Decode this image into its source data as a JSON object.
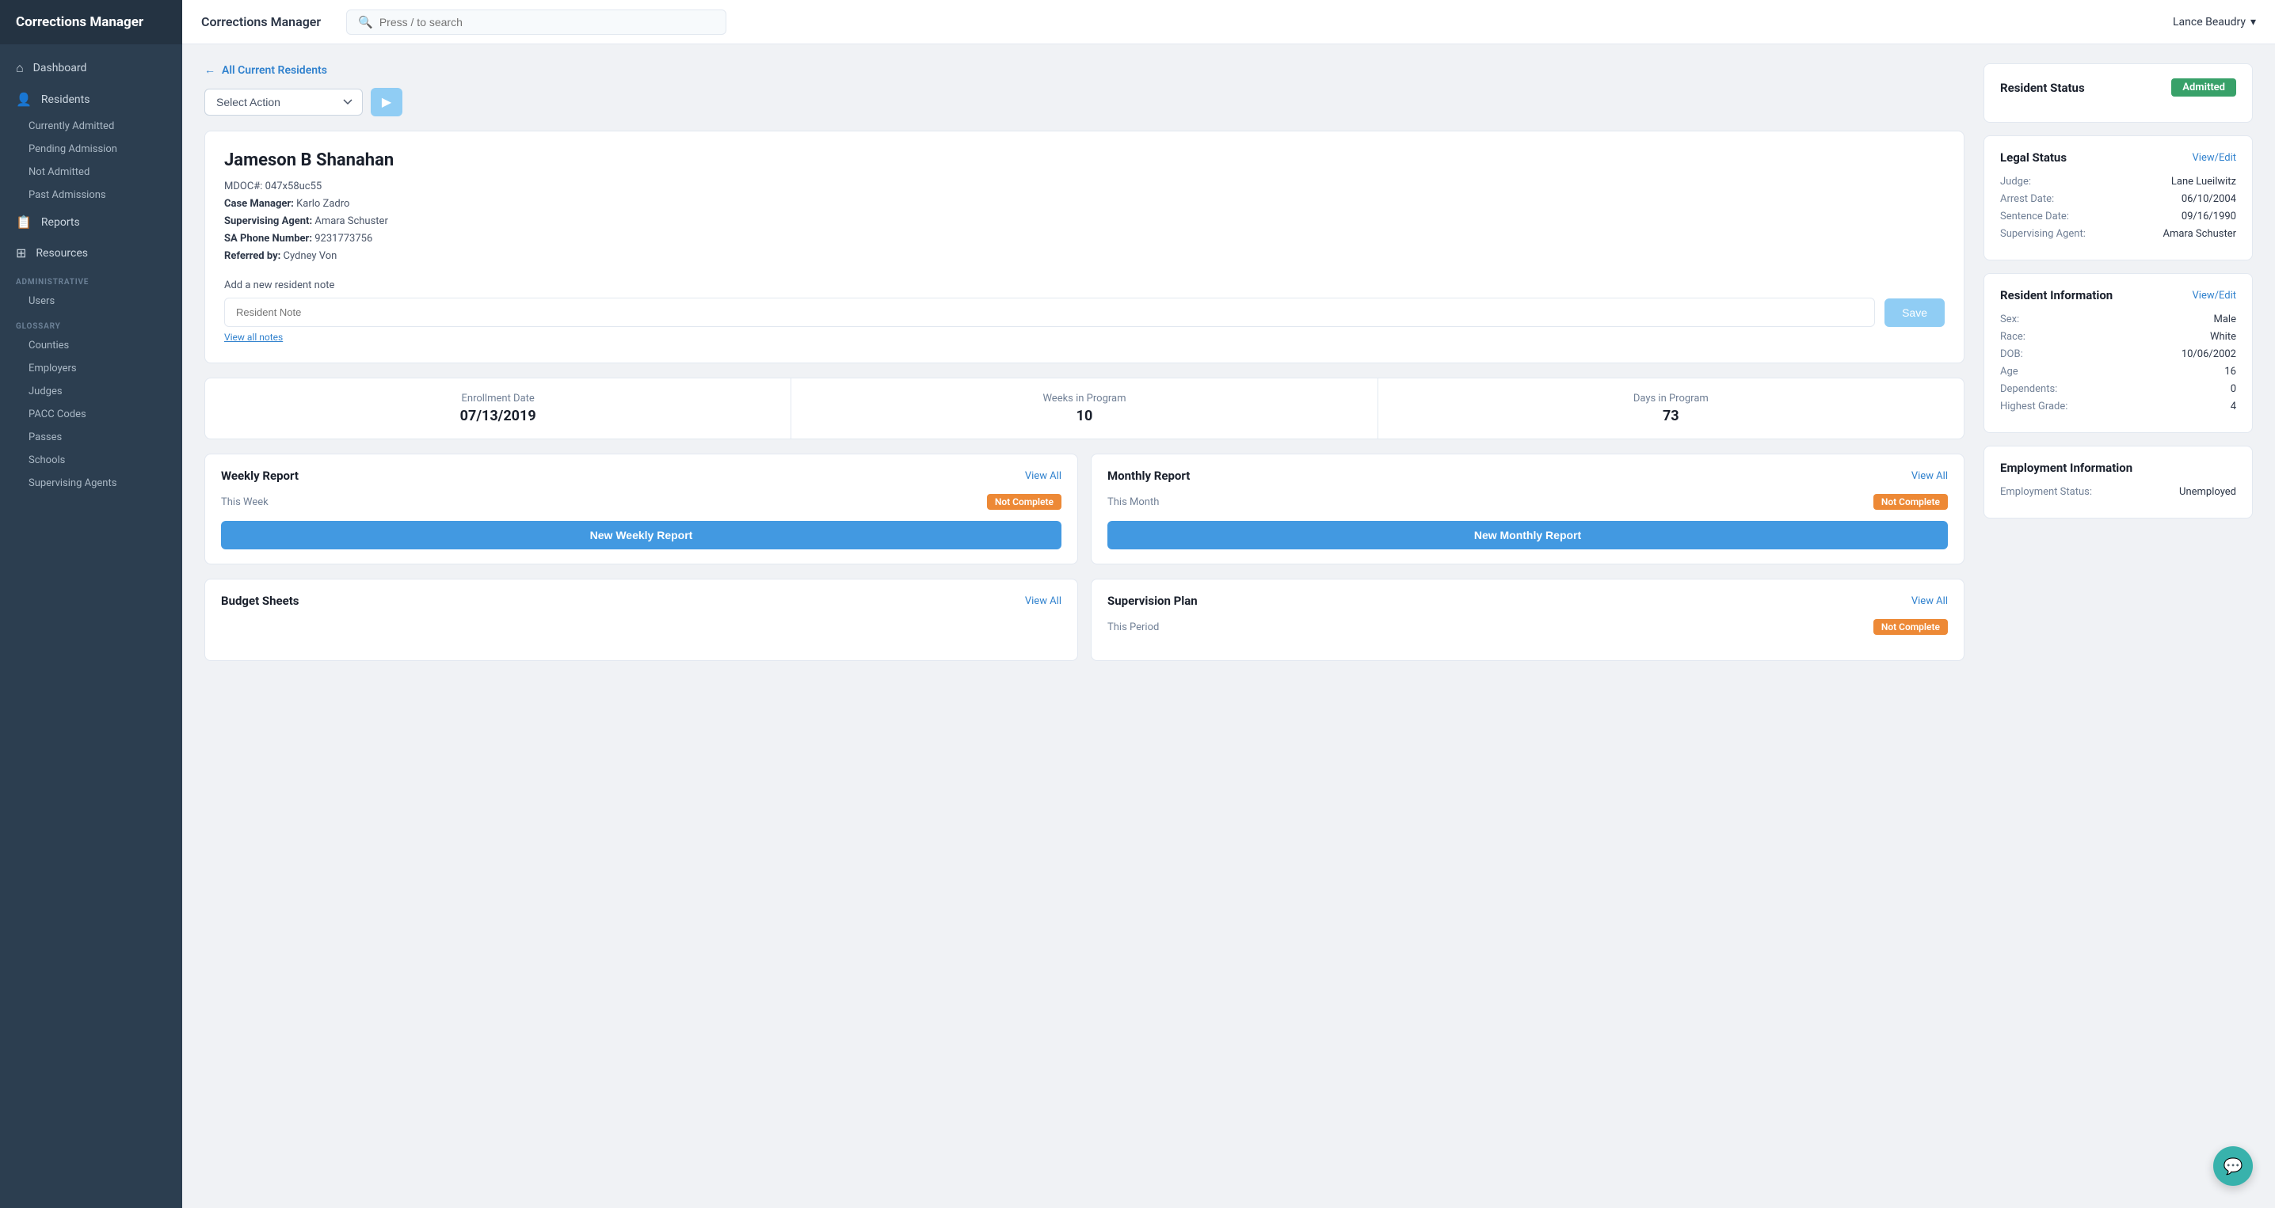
{
  "sidebar": {
    "logo": "Corrections Manager",
    "nav": [
      {
        "id": "dashboard",
        "label": "Dashboard",
        "icon": "⌂"
      },
      {
        "id": "residents",
        "label": "Residents",
        "icon": "👤"
      }
    ],
    "residents_sub": [
      {
        "id": "currently-admitted",
        "label": "Currently Admitted"
      },
      {
        "id": "pending-admission",
        "label": "Pending Admission"
      },
      {
        "id": "not-admitted",
        "label": "Not Admitted"
      },
      {
        "id": "past-admissions",
        "label": "Past Admissions"
      }
    ],
    "nav2": [
      {
        "id": "reports",
        "label": "Reports",
        "icon": "📋"
      },
      {
        "id": "resources",
        "label": "Resources",
        "icon": "⊞"
      }
    ],
    "section_admin": "ADMINISTRATIVE",
    "admin_items": [
      {
        "id": "users",
        "label": "Users"
      }
    ],
    "section_glossary": "GLOSSARY",
    "glossary_items": [
      {
        "id": "counties",
        "label": "Counties"
      },
      {
        "id": "employers",
        "label": "Employers"
      },
      {
        "id": "judges",
        "label": "Judges"
      },
      {
        "id": "pacc-codes",
        "label": "PACC Codes"
      },
      {
        "id": "passes",
        "label": "Passes"
      },
      {
        "id": "schools",
        "label": "Schools"
      },
      {
        "id": "supervising-agents",
        "label": "Supervising Agents"
      }
    ]
  },
  "topbar": {
    "title": "Corrections Manager",
    "search_placeholder": "Press / to search",
    "user": "Lance Beaudry"
  },
  "breadcrumb": "All Current Residents",
  "action_bar": {
    "select_label": "Select Action",
    "run_icon": "▶"
  },
  "resident": {
    "name": "Jameson B Shanahan",
    "mdoc": "MDOC#: 047x58uc55",
    "case_manager_label": "Case Manager:",
    "case_manager": "Karlo Zadro",
    "supervising_agent_label": "Supervising Agent:",
    "supervising_agent": "Amara Schuster",
    "sa_phone_label": "SA Phone Number:",
    "sa_phone": "9231773756",
    "referred_by_label": "Referred by:",
    "referred_by": "Cydney Von"
  },
  "note": {
    "label": "Add a new resident note",
    "placeholder": "Resident Note",
    "save_label": "Save",
    "view_all_label": "View all notes"
  },
  "stats": [
    {
      "label": "Enrollment Date",
      "value": "07/13/2019"
    },
    {
      "label": "Weeks in Program",
      "value": "10"
    },
    {
      "label": "Days in Program",
      "value": "73"
    }
  ],
  "reports": [
    {
      "id": "weekly-report",
      "title": "Weekly Report",
      "view_all": "View All",
      "period": "This Week",
      "status": "Not Complete",
      "button_label": "New Weekly Report"
    },
    {
      "id": "monthly-report",
      "title": "Monthly Report",
      "view_all": "View All",
      "period": "This Month",
      "status": "Not Complete",
      "button_label": "New Monthly Report"
    }
  ],
  "lower_cards": [
    {
      "id": "budget-sheets",
      "title": "Budget Sheets",
      "view_all": "View All"
    },
    {
      "id": "supervision-plan",
      "title": "Supervision Plan",
      "view_all": "View All"
    }
  ],
  "right_panel": {
    "resident_status": {
      "title": "Resident Status",
      "badge": "Admitted"
    },
    "legal_status": {
      "title": "Legal Status",
      "link": "View/Edit",
      "fields": [
        {
          "label": "Judge:",
          "value": "Lane Lueilwitz"
        },
        {
          "label": "Arrest Date:",
          "value": "06/10/2004"
        },
        {
          "label": "Sentence Date:",
          "value": "09/16/1990"
        },
        {
          "label": "Supervising Agent:",
          "value": "Amara Schuster"
        }
      ]
    },
    "resident_info": {
      "title": "Resident Information",
      "link": "View/Edit",
      "fields": [
        {
          "label": "Sex:",
          "value": "Male"
        },
        {
          "label": "Race:",
          "value": "White"
        },
        {
          "label": "DOB:",
          "value": "10/06/2002"
        },
        {
          "label": "Age",
          "value": "16"
        },
        {
          "label": "Dependents:",
          "value": "0"
        },
        {
          "label": "Highest Grade:",
          "value": "4"
        }
      ]
    },
    "employment_info": {
      "title": "Employment Information",
      "fields": [
        {
          "label": "Employment Status:",
          "value": "Unemployed"
        }
      ]
    }
  }
}
